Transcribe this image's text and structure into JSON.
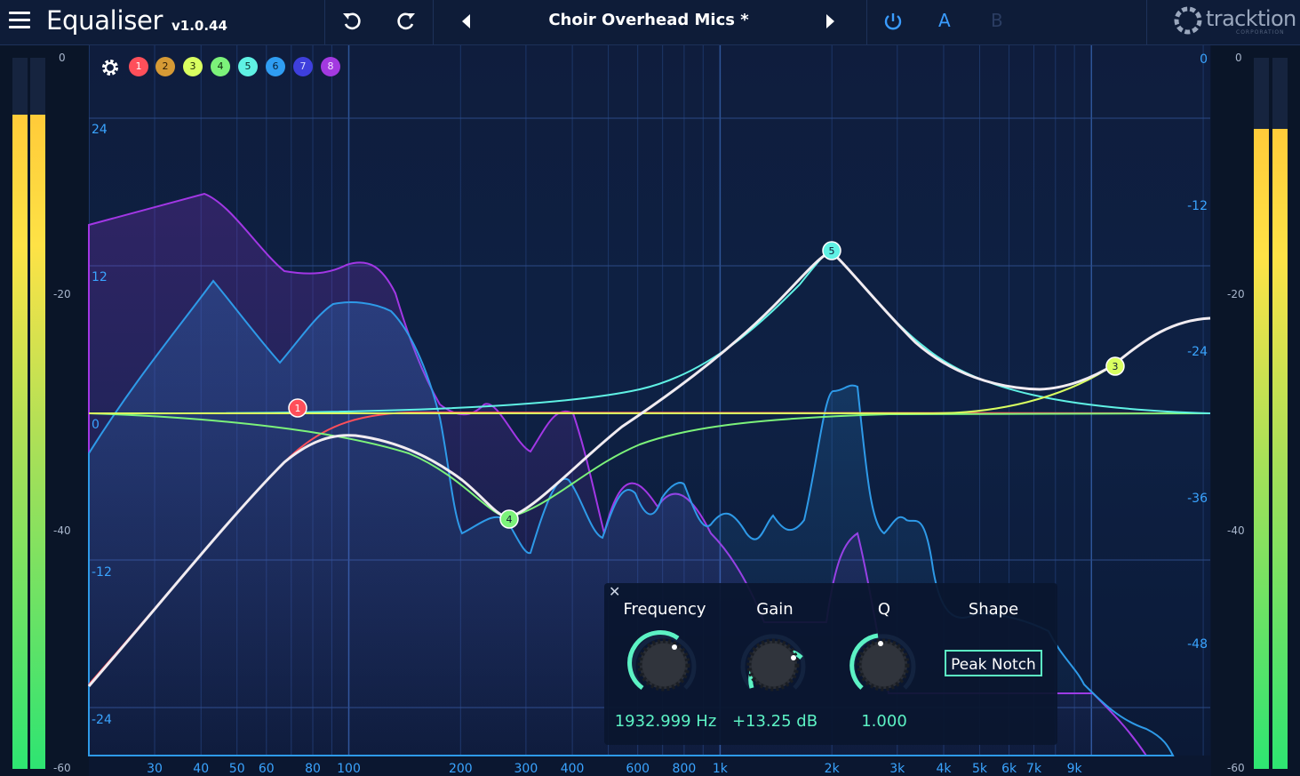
{
  "header": {
    "title": "Equaliser",
    "version": "v1.0.44",
    "preset_name": "Choir Overhead Mics *",
    "ab_a": "A",
    "ab_b": "B",
    "logo_text": "tracktion",
    "logo_sub": "CORPORATION",
    "icons": [
      "menu-icon",
      "undo-icon",
      "redo-icon",
      "previous-preset-icon",
      "next-preset-icon",
      "power-icon"
    ]
  },
  "colors": {
    "accent": "#3a9cff",
    "value_text": "#5cf2c4",
    "band1": "#ff4f5a",
    "band2": "#d69a35",
    "band3": "#d9ff60",
    "band4": "#7cf27a",
    "band5": "#5ff1e4",
    "band6": "#2f9df2",
    "band7": "#3e3fdd",
    "band8": "#a339e0",
    "combined_curve": "#f1ecf1",
    "spectrum_in": "#a237e5",
    "spectrum_out": "#2e9ae8"
  },
  "bands": [
    "1",
    "2",
    "3",
    "4",
    "5",
    "6",
    "7",
    "8"
  ],
  "freq_axis_labels": [
    "30",
    "40",
    "50",
    "60",
    "80",
    "100",
    "200",
    "300",
    "400",
    "600",
    "800",
    "1k",
    "2k",
    "3k",
    "4k",
    "5k",
    "6k",
    "7k",
    "9k"
  ],
  "gain_axis_labels": [
    "24",
    "12",
    "0",
    "-12",
    "-24"
  ],
  "spectrum_axis_labels": [
    "0",
    "-12",
    "-24",
    "-36",
    "-48"
  ],
  "meters": {
    "scale_labels": [
      "0",
      "-20",
      "-40",
      "-60"
    ],
    "left_levels": [
      0.92,
      0.92
    ],
    "right_levels": [
      0.9,
      0.9
    ]
  },
  "params": {
    "frequency_label": "Frequency",
    "frequency_value": "1932.999 Hz",
    "gain_label": "Gain",
    "gain_value": "+13.25 dB",
    "q_label": "Q",
    "q_value": "1.000",
    "shape_label": "Shape",
    "shape_value": "Peak Notch"
  }
}
